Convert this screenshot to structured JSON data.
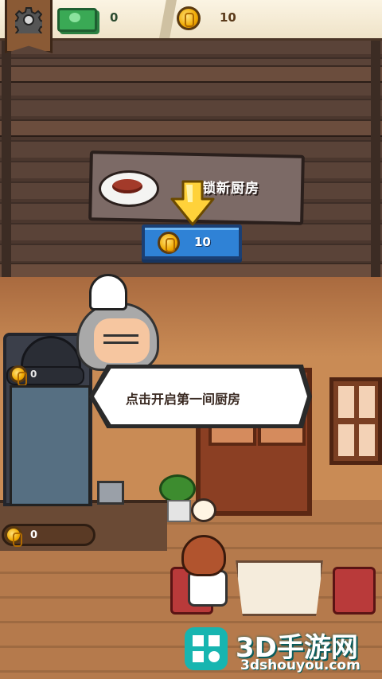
{
  "hud": {
    "cash_value": "0",
    "gold_value": "10"
  },
  "unlock": {
    "sign_text": "解锁新厨房",
    "cost": "10"
  },
  "dialog": {
    "text": "点击开启第一间厨房"
  },
  "cabinet": {
    "counter_value": "0"
  },
  "bottom_bar": {
    "coin_value": "0"
  },
  "watermark": {
    "logo_text": "3D手游网",
    "url": "3dshouyou.com"
  },
  "icons": [
    "gear-icon",
    "cash-icon",
    "coin-icon",
    "arrow-down-icon",
    "plate-food-icon",
    "order-icon"
  ]
}
